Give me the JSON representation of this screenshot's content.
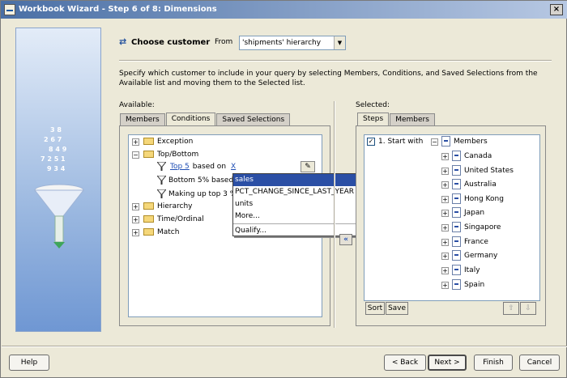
{
  "window": {
    "title": "Workbook Wizard - Step 6 of 8: Dimensions",
    "close_label": "×"
  },
  "header": {
    "title": "Choose customer",
    "from_label": "From",
    "hierarchy_value": "'shipments' hierarchy"
  },
  "description": "Specify which customer to include in your query by selecting Members, Conditions, and Saved Selections from the Available list and moving them to the Selected list.",
  "available": {
    "label": "Available:",
    "tabs": [
      "Members",
      "Conditions",
      "Saved Selections"
    ],
    "active_tab": "Conditions",
    "tree": {
      "exception": "Exception",
      "top_bottom": "Top/Bottom",
      "cond1_link": "Top 5",
      "cond1_middle": "based on",
      "cond1_field": "X",
      "cond2": "Bottom 5% based",
      "cond3": "Making up top 3 %",
      "hierarchy": "Hierarchy",
      "time_ordinal": "Time/Ordinal",
      "match": "Match"
    }
  },
  "popup": {
    "items": [
      "sales",
      "PCT_CHANGE_SINCE_LAST_YEAR",
      "units",
      "More...",
      "Qualify..."
    ],
    "selected": "sales"
  },
  "move_button": "«",
  "selected": {
    "label": "Selected:",
    "tabs": [
      "Steps",
      "Members"
    ],
    "active_tab": "Steps",
    "step1": "1. Start with",
    "members_root": "Members",
    "members": [
      "Canada",
      "United States",
      "Australia",
      "Hong Kong",
      "Japan",
      "Singapore",
      "France",
      "Germany",
      "Italy",
      "Spain"
    ],
    "sort_label": "Sort",
    "save_label": "Save",
    "up_label": "⇧",
    "down_label": "⇩"
  },
  "footer": {
    "help": "Help",
    "back": "< Back",
    "next": "Next >",
    "finish": "Finish",
    "cancel": "Cancel"
  }
}
